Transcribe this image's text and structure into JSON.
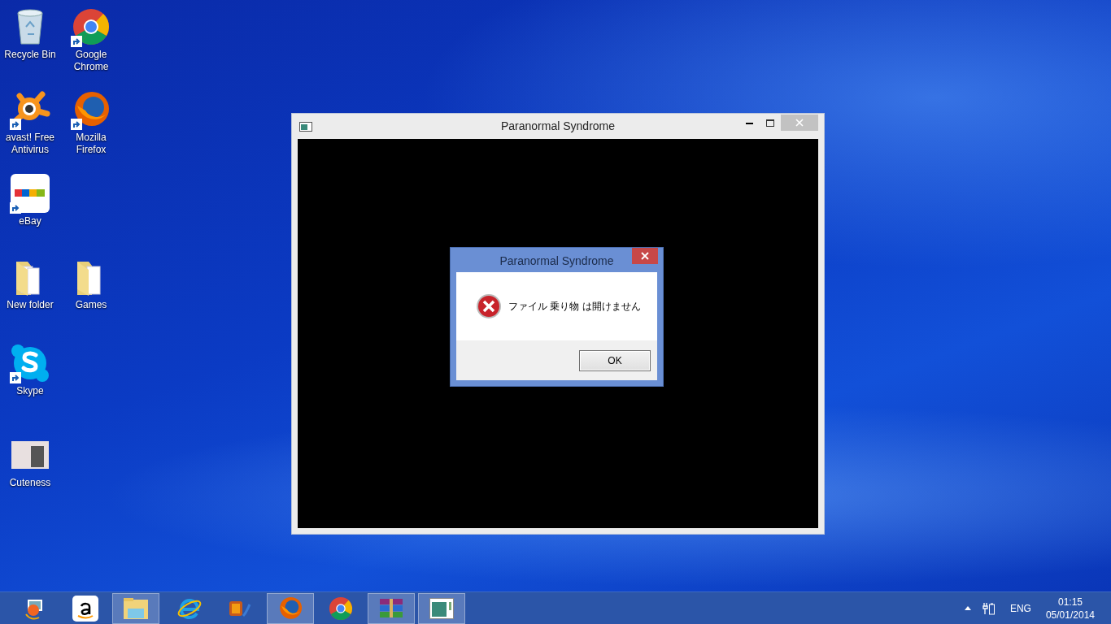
{
  "desktop_icons": [
    {
      "label": "Recycle Bin",
      "shortcut": false
    },
    {
      "label": "Google\nChrome",
      "shortcut": true
    },
    {
      "label": "avast! Free\nAntivirus",
      "shortcut": true
    },
    {
      "label": "Mozilla\nFirefox",
      "shortcut": true
    },
    {
      "label": "eBay",
      "shortcut": true
    },
    {
      "label": "New folder",
      "shortcut": false
    },
    {
      "label": "Games",
      "shortcut": false
    },
    {
      "label": "Skype",
      "shortcut": true
    },
    {
      "label": "Cuteness",
      "shortcut": false
    }
  ],
  "window": {
    "title": "Paranormal Syndrome"
  },
  "dialog": {
    "title": "Paranormal Syndrome",
    "message": "ファイル 乗り物 は開けません",
    "button": "OK"
  },
  "taskbar": {
    "buttons": [
      {
        "open": false
      },
      {
        "open": false
      },
      {
        "open": true
      },
      {
        "open": false
      },
      {
        "open": false
      },
      {
        "open": true
      },
      {
        "open": false
      },
      {
        "open": true
      },
      {
        "open": true
      }
    ],
    "language": "ENG",
    "time": "01:15",
    "date": "05/01/2014"
  }
}
